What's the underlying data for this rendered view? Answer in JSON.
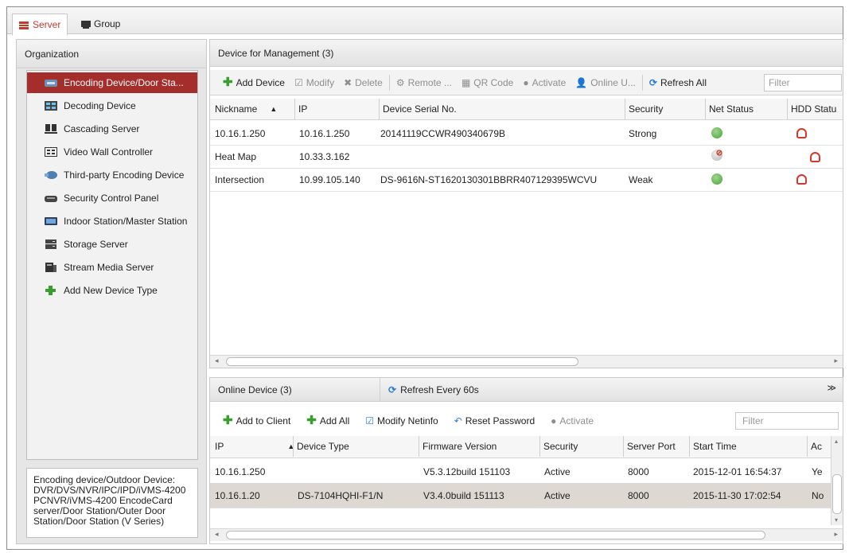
{
  "tabs": [
    {
      "label": "Server",
      "active": true
    },
    {
      "label": "Group",
      "active": false
    }
  ],
  "organization": {
    "title": "Organization",
    "items": [
      {
        "label": "Encoding Device/Door Sta...",
        "icon": "encoding-device-icon",
        "selected": true
      },
      {
        "label": "Decoding Device",
        "icon": "decoding-device-icon"
      },
      {
        "label": "Cascading Server",
        "icon": "cascading-server-icon"
      },
      {
        "label": "Video Wall Controller",
        "icon": "video-wall-icon"
      },
      {
        "label": "Third-party Encoding Device",
        "icon": "third-party-icon"
      },
      {
        "label": "Security Control Panel",
        "icon": "security-panel-icon"
      },
      {
        "label": "Indoor Station/Master Station",
        "icon": "indoor-station-icon"
      },
      {
        "label": "Storage Server",
        "icon": "storage-server-icon"
      },
      {
        "label": "Stream Media Server",
        "icon": "stream-media-icon"
      },
      {
        "label": "Add New Device Type",
        "icon": "plus-icon"
      }
    ],
    "description": "Encoding device/Outdoor Device: DVR/DVS/NVR/IPC/IPD/iVMS-4200 PCNVR/iVMS-4200 EncodeCard server/Door Station/Outer Door Station/Door Station (V Series)"
  },
  "management": {
    "title": "Device for Management (3)",
    "toolbar": {
      "add_device": "Add Device",
      "modify": "Modify",
      "delete": "Delete",
      "remote": "Remote ...",
      "qr_code": "QR Code",
      "activate": "Activate",
      "online_user": "Online U...",
      "refresh_all": "Refresh All",
      "filter_placeholder": "Filter"
    },
    "columns": {
      "nickname": "Nickname",
      "ip": "IP",
      "serial": "Device Serial No.",
      "security": "Security",
      "net_status": "Net Status",
      "hdd_status": "HDD Statu"
    },
    "rows": [
      {
        "nickname": "10.16.1.250",
        "ip": "10.16.1.250",
        "serial": "20141119CCWR490340679B",
        "security": "Strong",
        "net": "online"
      },
      {
        "nickname": "Heat Map",
        "ip": "10.33.3.162",
        "serial": "",
        "security": "",
        "net": "offline"
      },
      {
        "nickname": "Intersection",
        "ip": "10.99.105.140",
        "serial": "DS-9616N-ST1620130301BBRR407129395WCVU",
        "security": "Weak",
        "net": "online"
      }
    ]
  },
  "online": {
    "title": "Online Device (3)",
    "refresh": "Refresh Every 60s",
    "toolbar": {
      "add_to_client": "Add to Client",
      "add_all": "Add All",
      "modify_netinfo": "Modify Netinfo",
      "reset_password": "Reset Password",
      "activate": "Activate",
      "filter_placeholder": "Filter"
    },
    "columns": {
      "ip": "IP",
      "device_type": "Device Type",
      "firmware": "Firmware Version",
      "security": "Security",
      "server_port": "Server Port",
      "start_time": "Start Time",
      "added": "Ac"
    },
    "rows": [
      {
        "ip": "10.16.1.250",
        "device_type": "",
        "firmware": "V5.3.12build 151103",
        "security": "Active",
        "port": "8000",
        "start": "2015-12-01 16:54:37",
        "added": "Ye"
      },
      {
        "ip": "10.16.1.20",
        "device_type": "DS-7104HQHI-F1/N",
        "firmware": "V3.4.0build 151113",
        "security": "Active",
        "port": "8000",
        "start": "2015-11-30 17:02:54",
        "added": "No"
      }
    ]
  },
  "colors": {
    "accent": "#a32e2c",
    "tab_active_text": "#c23b2b",
    "green": "#3a9e2f",
    "blue": "#2e7fd0"
  }
}
